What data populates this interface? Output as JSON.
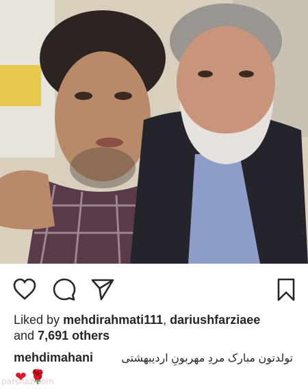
{
  "post": {
    "photo_alt": "",
    "likes": {
      "prefix": "Liked by",
      "user1": "mehdirahmati111",
      "separator": ",",
      "user2": "dariushfarziaee",
      "and": "and",
      "count": "7,691 others"
    },
    "caption": {
      "owner": "mehdimahani",
      "text": "تولدتون مبارک مردِ مهربونِ اردیبهشتی",
      "emojis": [
        "❤",
        "🌹"
      ]
    },
    "watermark": "parsnaz.com"
  },
  "icons": {
    "like": "heart-outline-icon",
    "comment": "comment-bubble-icon",
    "share": "paper-plane-icon",
    "save": "bookmark-icon"
  },
  "colors": {
    "text": "#262626",
    "heart_emoji": "#e0162b",
    "background": "#ffffff"
  }
}
